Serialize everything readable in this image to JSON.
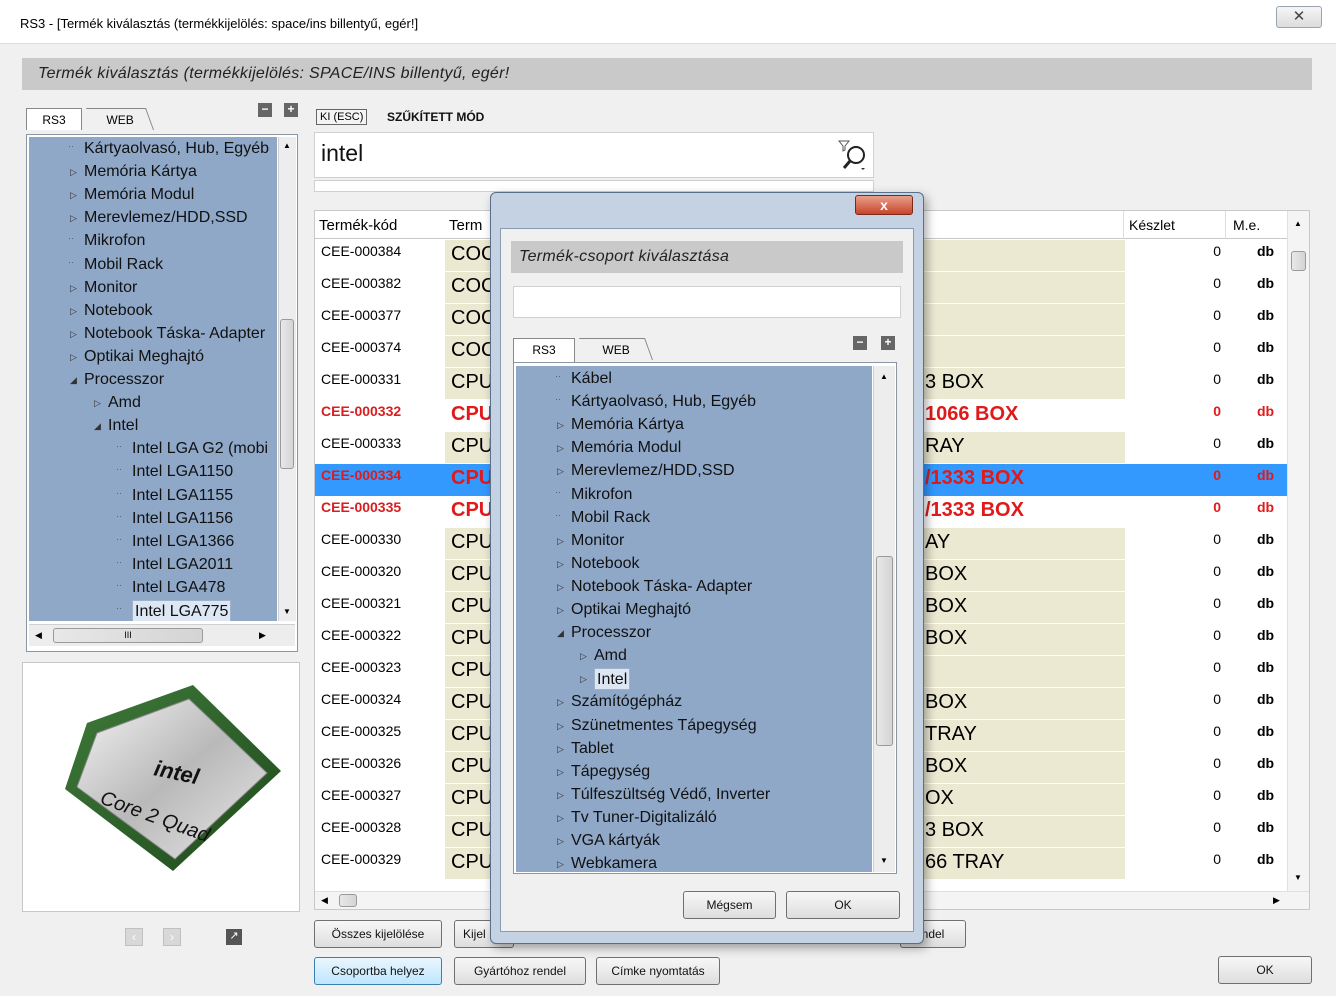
{
  "window": {
    "title": "RS3 - [Termék kiválasztás (termékkijelölés: space/ins billentyű, egér!]",
    "header": "Termék kiválasztás (termékkijelölés: SPACE/INS billentyű, egér!",
    "close_icon": "✕"
  },
  "left_panel": {
    "tabs": [
      "RS3",
      "WEB"
    ],
    "tree": [
      {
        "label": "Kártyaolvasó, Hub, Egyéb",
        "arrow": false,
        "level": 0
      },
      {
        "label": "Memória Kártya",
        "arrow": "collapsed",
        "level": 0
      },
      {
        "label": "Memória Modul",
        "arrow": "collapsed",
        "level": 0
      },
      {
        "label": "Merevlemez/HDD,SSD",
        "arrow": "collapsed",
        "level": 0
      },
      {
        "label": "Mikrofon",
        "arrow": false,
        "level": 0
      },
      {
        "label": "Mobil Rack",
        "arrow": false,
        "level": 0
      },
      {
        "label": "Monitor",
        "arrow": "collapsed",
        "level": 0
      },
      {
        "label": "Notebook",
        "arrow": "collapsed",
        "level": 0
      },
      {
        "label": "Notebook Táska- Adapter",
        "arrow": "collapsed",
        "level": 0
      },
      {
        "label": "Optikai Meghajtó",
        "arrow": "collapsed",
        "level": 0
      },
      {
        "label": "Processzor",
        "arrow": "expanded",
        "level": 0
      },
      {
        "label": "Amd",
        "arrow": "collapsed",
        "level": 1
      },
      {
        "label": "Intel",
        "arrow": "expanded",
        "level": 1
      },
      {
        "label": "Intel LGA G2 (mobi",
        "arrow": false,
        "level": 2
      },
      {
        "label": "Intel LGA1150",
        "arrow": false,
        "level": 2
      },
      {
        "label": "Intel LGA1155",
        "arrow": false,
        "level": 2
      },
      {
        "label": "Intel LGA1156",
        "arrow": false,
        "level": 2
      },
      {
        "label": "Intel LGA1366",
        "arrow": false,
        "level": 2
      },
      {
        "label": "Intel LGA2011",
        "arrow": false,
        "level": 2
      },
      {
        "label": "Intel LGA478",
        "arrow": false,
        "level": 2
      },
      {
        "label": "Intel LGA775",
        "arrow": false,
        "level": 2,
        "selected": true
      }
    ],
    "hscroll_grip": "III",
    "image": {
      "brand": "intel",
      "product": "Core 2 Quad"
    }
  },
  "main": {
    "ki_button": "KI (ESC)",
    "mode_label": "SZŰKÍTETT MÓD",
    "search": {
      "value": "intel",
      "icon": "filter-search-icon"
    },
    "columns": {
      "code": "Termék-kód",
      "name": "Term",
      "stock": "Készlet",
      "unit": "M.e."
    },
    "rows": [
      {
        "code": "CEE-000384",
        "left": "COC",
        "right": "",
        "stock": "0",
        "unit": "db",
        "style": "normal"
      },
      {
        "code": "CEE-000382",
        "left": "COC",
        "right": "",
        "stock": "0",
        "unit": "db",
        "style": "normal"
      },
      {
        "code": "CEE-000377",
        "left": "COC",
        "right": "",
        "stock": "0",
        "unit": "db",
        "style": "normal"
      },
      {
        "code": "CEE-000374",
        "left": "COC",
        "right": "",
        "stock": "0",
        "unit": "db",
        "style": "normal"
      },
      {
        "code": "CEE-000331",
        "left": "CPU",
        "right": "3 BOX",
        "stock": "0",
        "unit": "db",
        "style": "normal"
      },
      {
        "code": "CEE-000332",
        "left": "CPU",
        "right": "1066 BOX",
        "stock": "0",
        "unit": "db",
        "style": "red"
      },
      {
        "code": "CEE-000333",
        "left": "CPU",
        "right": "RAY",
        "stock": "0",
        "unit": "db",
        "style": "normal"
      },
      {
        "code": "CEE-000334",
        "left": "CPU",
        "right": "/1333 BOX",
        "stock": "0",
        "unit": "db",
        "style": "selected"
      },
      {
        "code": "CEE-000335",
        "left": "CPU",
        "right": "/1333 BOX",
        "stock": "0",
        "unit": "db",
        "style": "red"
      },
      {
        "code": "CEE-000330",
        "left": "CPU",
        "right": "AY",
        "stock": "0",
        "unit": "db",
        "style": "normal"
      },
      {
        "code": "CEE-000320",
        "left": "CPU",
        "right": "BOX",
        "stock": "0",
        "unit": "db",
        "style": "normal"
      },
      {
        "code": "CEE-000321",
        "left": "CPU",
        "right": "BOX",
        "stock": "0",
        "unit": "db",
        "style": "normal"
      },
      {
        "code": "CEE-000322",
        "left": "CPU",
        "right": "BOX",
        "stock": "0",
        "unit": "db",
        "style": "normal"
      },
      {
        "code": "CEE-000323",
        "left": "CPU",
        "right": "",
        "stock": "0",
        "unit": "db",
        "style": "normal"
      },
      {
        "code": "CEE-000324",
        "left": "CPU",
        "right": "BOX",
        "stock": "0",
        "unit": "db",
        "style": "normal"
      },
      {
        "code": "CEE-000325",
        "left": "CPU",
        "right": "TRAY",
        "stock": "0",
        "unit": "db",
        "style": "normal"
      },
      {
        "code": "CEE-000326",
        "left": "CPU",
        "right": "BOX",
        "stock": "0",
        "unit": "db",
        "style": "normal"
      },
      {
        "code": "CEE-000327",
        "left": "CPU",
        "right": "OX",
        "stock": "0",
        "unit": "db",
        "style": "normal"
      },
      {
        "code": "CEE-000328",
        "left": "CPU",
        "right": "3 BOX",
        "stock": "0",
        "unit": "db",
        "style": "normal"
      },
      {
        "code": "CEE-000329",
        "left": "CPU",
        "right": "66 TRAY",
        "stock": "0",
        "unit": "db",
        "style": "normal"
      }
    ],
    "buttons_row1": {
      "select_all": "Összes kijelölése",
      "kijel": "Kijel",
      "endel": "ndel"
    },
    "buttons_row2": {
      "group": "Csoportba helyez",
      "manufacturer": "Gyártóhoz rendel",
      "label_print": "Címke nyomtatás"
    },
    "ok": "OK"
  },
  "dialog": {
    "title": "Termék-csoport kiválasztása",
    "close_icon": "x",
    "tabs": [
      "RS3",
      "WEB"
    ],
    "tree": [
      {
        "label": "Kábel",
        "arrow": false,
        "level": 0
      },
      {
        "label": "Kártyaolvasó, Hub, Egyéb",
        "arrow": false,
        "level": 0
      },
      {
        "label": "Memória Kártya",
        "arrow": "collapsed",
        "level": 0
      },
      {
        "label": "Memória Modul",
        "arrow": "collapsed",
        "level": 0
      },
      {
        "label": "Merevlemez/HDD,SSD",
        "arrow": "collapsed",
        "level": 0
      },
      {
        "label": "Mikrofon",
        "arrow": false,
        "level": 0
      },
      {
        "label": "Mobil Rack",
        "arrow": false,
        "level": 0
      },
      {
        "label": "Monitor",
        "arrow": "collapsed",
        "level": 0
      },
      {
        "label": "Notebook",
        "arrow": "collapsed",
        "level": 0
      },
      {
        "label": "Notebook Táska- Adapter",
        "arrow": "collapsed",
        "level": 0
      },
      {
        "label": "Optikai Meghajtó",
        "arrow": "collapsed",
        "level": 0
      },
      {
        "label": "Processzor",
        "arrow": "expanded",
        "level": 0
      },
      {
        "label": "Amd",
        "arrow": "collapsed",
        "level": 1
      },
      {
        "label": "Intel",
        "arrow": "collapsed",
        "level": 1,
        "selected": true
      },
      {
        "label": "Számítógépház",
        "arrow": "collapsed",
        "level": 0
      },
      {
        "label": "Szünetmentes Tápegység",
        "arrow": "collapsed",
        "level": 0
      },
      {
        "label": "Tablet",
        "arrow": "collapsed",
        "level": 0
      },
      {
        "label": "Tápegység",
        "arrow": "collapsed",
        "level": 0
      },
      {
        "label": "Túlfeszültség Védő, Inverter",
        "arrow": "collapsed",
        "level": 0
      },
      {
        "label": "Tv Tuner-Digitalizáló",
        "arrow": "collapsed",
        "level": 0
      },
      {
        "label": "VGA kártyák",
        "arrow": "collapsed",
        "level": 0
      },
      {
        "label": "Webkamera",
        "arrow": "collapsed",
        "level": 0
      }
    ],
    "cancel": "Mégsem",
    "ok": "OK"
  },
  "colors": {
    "tree_bg": "#8fa8c8",
    "red_text": "#e01a1a",
    "selection": "#3399ff",
    "name_cell": "#ebe9d2"
  }
}
